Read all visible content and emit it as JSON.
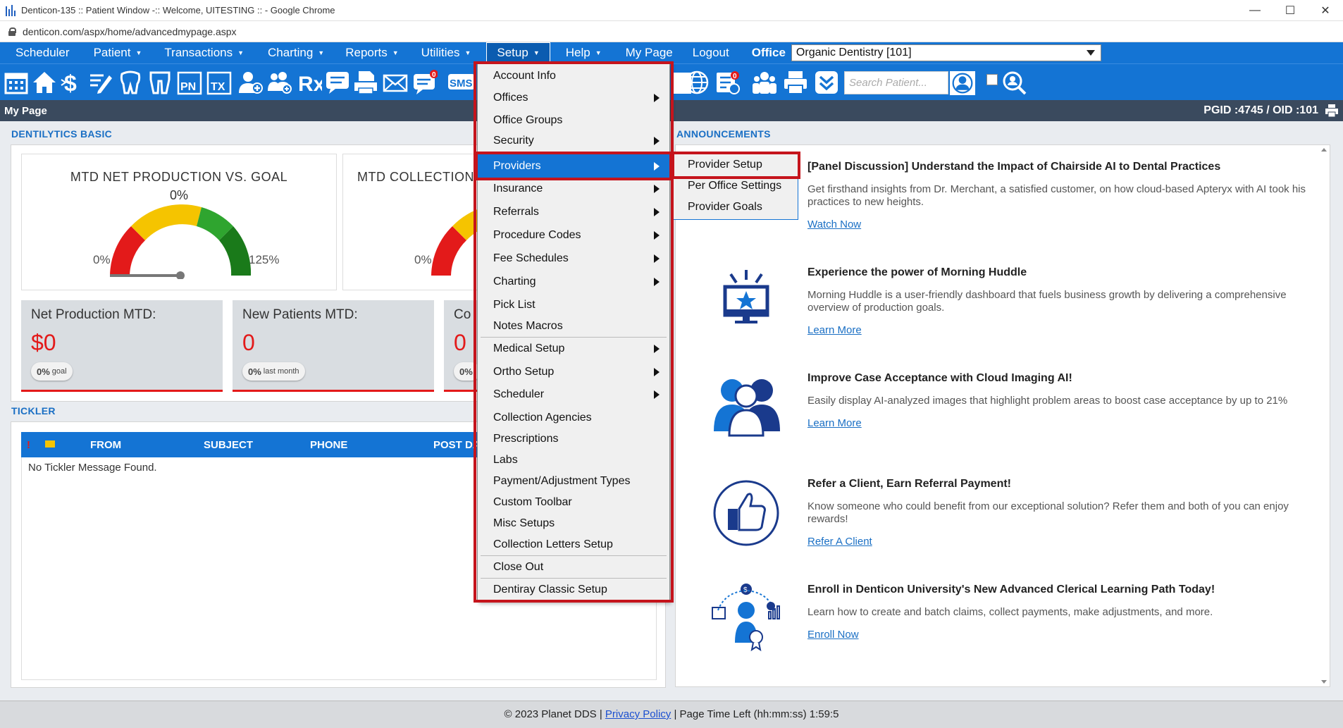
{
  "browser": {
    "title": "Denticon-135 :: Patient Window -:: Welcome, UITESTING :: - Google Chrome",
    "url": "denticon.com/aspx/home/advancedmypage.aspx",
    "minimize": "—",
    "maximize": "☐",
    "close": "✕"
  },
  "nav": {
    "items": [
      "Scheduler",
      "Patient",
      "Transactions",
      "Charting",
      "Reports",
      "Utilities",
      "Setup",
      "Help",
      "My Page",
      "Logout"
    ],
    "office_label": "Office",
    "office_value": "Organic Dentistry [101]"
  },
  "toolbar": {
    "search_placeholder": "Search Patient...",
    "icons": [
      "calendar-icon",
      "home-icon",
      "dollar-icon",
      "note-edit-icon",
      "tooth-icon",
      "teeth-icon",
      "pn-icon",
      "tx-icon",
      "add-patient-icon",
      "add-family-icon",
      "rx-icon",
      "message-icon",
      "printer-doc-icon",
      "email-icon",
      "chat-icon",
      "sms-icon"
    ],
    "pn": "PN",
    "tx": "TX",
    "rx": "Rx",
    "sms": "SMS",
    "badge": "0"
  },
  "page": {
    "title": "My Page",
    "ids": "PGID :4745  /  OID :101"
  },
  "dentilytics": {
    "title": "DENTILYTICS BASIC",
    "gauge1": {
      "title": "MTD NET PRODUCTION VS. GOAL",
      "value": "0%",
      "min": "0%",
      "max": "125%",
      "level": 0
    },
    "gauge2": {
      "title": "MTD COLLECTION",
      "min": "0%"
    },
    "metrics": [
      {
        "label": "Net Production MTD:",
        "value": "$0",
        "pill_pct": "0%",
        "pill_txt": "goal"
      },
      {
        "label": "New Patients MTD:",
        "value": "0",
        "pill_pct": "0%",
        "pill_txt": "last month"
      },
      {
        "label": "Co",
        "value": "0",
        "pill_pct": "0%",
        "pill_txt": ""
      }
    ]
  },
  "tickler": {
    "title": "TICKLER",
    "columns": [
      "FROM",
      "SUBJECT",
      "PHONE",
      "POST DA"
    ],
    "flag": "!",
    "empty": "No Tickler Message Found."
  },
  "announcements": {
    "title": "ANNOUNCEMENTS",
    "items": [
      {
        "heading": "[Panel Discussion] Understand the Impact of Chairside AI to Dental Practices",
        "desc": "Get firsthand insights from Dr. Merchant, a satisfied customer, on how cloud-based Apteryx with AI took his practices to new heights.",
        "link": "Watch Now"
      },
      {
        "heading": "Experience the power of Morning Huddle",
        "desc": "Morning Huddle is a user-friendly dashboard that fuels business growth by delivering a comprehensive overview of production goals.",
        "link": "Learn More"
      },
      {
        "heading": "Improve Case Acceptance with Cloud Imaging AI!",
        "desc": "Easily display AI-analyzed images that highlight problem areas to boost case acceptance by up to 21%",
        "link": "Learn More"
      },
      {
        "heading": "Refer a Client, Earn Referral Payment!",
        "desc": "Know someone who could benefit from our exceptional solution? Refer them and both of you can enjoy rewards!",
        "link": "Refer A Client"
      },
      {
        "heading": "Enroll in Denticon University's New Advanced Clerical Learning Path Today!",
        "desc": "Learn how to create and batch claims, collect payments, make adjustments, and more.",
        "link": "Enroll Now"
      }
    ]
  },
  "setup_menu": {
    "items": [
      "Account Info",
      "Offices",
      "Office Groups",
      "Security",
      "Providers",
      "Insurance",
      "Referrals",
      "Procedure Codes",
      "Fee Schedules",
      "Charting",
      "Pick List",
      "Notes Macros",
      "Medical Setup",
      "Ortho Setup",
      "Scheduler",
      "Collection Agencies",
      "Prescriptions",
      "Labs",
      "Payment/Adjustment Types",
      "Custom Toolbar",
      "Misc Setups",
      "Collection Letters Setup",
      "Close Out",
      "Dentiray Classic Setup"
    ],
    "highlighted": "Providers"
  },
  "providers_submenu": {
    "items": [
      "Provider Setup",
      "Per Office Settings",
      "Provider Goals"
    ]
  },
  "footer": {
    "copyright": "© 2023 Planet DDS |",
    "privacy": "Privacy Policy",
    "time": "|  Page Time Left (hh:mm:ss) 1:59:5"
  },
  "colors": {
    "brand_blue": "#1474d4",
    "alert_red": "#e31a1a",
    "highlight_border": "#c5141c"
  }
}
